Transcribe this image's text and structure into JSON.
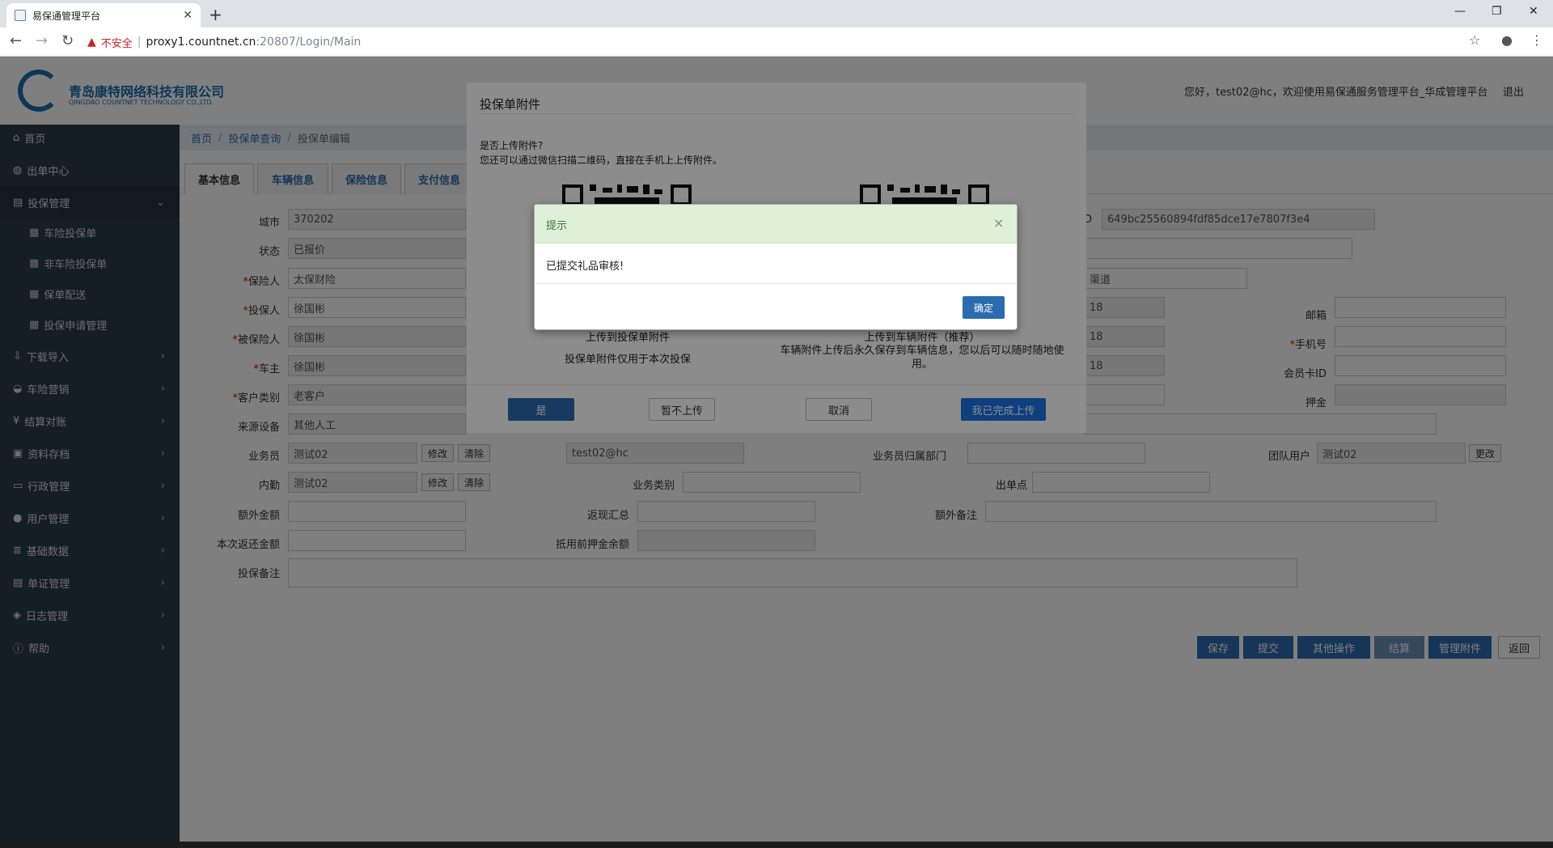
{
  "browser": {
    "tab_title": "易保通管理平台",
    "not_secure": "不安全",
    "url_host": "proxy1.countnet.cn",
    "url_rest": ":20807/Login/Main"
  },
  "header": {
    "company_cn": "青岛康特网络科技有限公司",
    "company_en": "QINGDAO COUNTNET TECHNOLOGY CO.,LTD.",
    "welcome": "您好，test02@hc，欢迎使用易保通服务管理平台_华成管理平台",
    "logout": "退出"
  },
  "sidebar": {
    "items": [
      {
        "label": "首页"
      },
      {
        "label": "出单中心"
      },
      {
        "label": "投保管理"
      },
      {
        "label": "车险投保单"
      },
      {
        "label": "非车险投保单"
      },
      {
        "label": "保单配送"
      },
      {
        "label": "投保申请管理"
      },
      {
        "label": "下载导入"
      },
      {
        "label": "车险营销"
      },
      {
        "label": "结算对账"
      },
      {
        "label": "资料存档"
      },
      {
        "label": "行政管理"
      },
      {
        "label": "用户管理"
      },
      {
        "label": "基础数据"
      },
      {
        "label": "单证管理"
      },
      {
        "label": "日志管理"
      },
      {
        "label": "帮助"
      }
    ]
  },
  "breadcrumb": [
    "首页",
    "投保单查询",
    "投保单编辑"
  ],
  "form_tabs": [
    "基本信息",
    "车辆信息",
    "保险信息",
    "支付信息"
  ],
  "form": {
    "city_label": "城市",
    "city_value": "370202",
    "status_label": "状态",
    "status_value": "已报价",
    "insurer_label": "保险人",
    "insurer_value": "太保财险",
    "applicant_label": "投保人",
    "applicant_value": "徐国彬",
    "insured_label": "被保险人",
    "insured_value": "徐国彬",
    "owner_label": "车主",
    "owner_value": "徐国彬",
    "customer_type_label": "客户类别",
    "customer_type_value": "老客户",
    "source_label": "来源设备",
    "source_value": "其他人工",
    "agent_label": "业务员",
    "agent_value": "测试02",
    "agent_account": "test02@hc",
    "internal_label": "内勤",
    "internal_value": "测试02",
    "modify": "修改",
    "clear": "清除",
    "dept_label": "业务员归属部门",
    "team_label": "团队用户",
    "team_value": "测试02",
    "team_change": "更改",
    "biz_type_label": "业务类别",
    "issue_point_label": "出单点",
    "extra_amount_label": "额外金额",
    "rebate_total_label": "返现汇总",
    "extra_note_label": "额外备注",
    "rebate_now_label": "本次返还金额",
    "deposit_balance_label": "抵用前押金余额",
    "note_label": "投保备注",
    "id_label": "ID",
    "id_value": "649bc25560894fdf85dce17e7807f3e4",
    "channel_value": "渠道",
    "email_label": "邮箱",
    "mobile_label": "手机号",
    "member_label": "会员卡ID",
    "deposit_label": "押金",
    "phone_tail": "18"
  },
  "actions": [
    "保存",
    "提交",
    "其他操作",
    "结算",
    "管理附件",
    "返回"
  ],
  "attach_dialog": {
    "title": "投保单附件",
    "question": "是否上传附件?",
    "hint": "您还可以通过微信扫描二维码，直接在手机上上传附件。",
    "upload_policy": "上传到投保单附件",
    "upload_policy_desc": "投保单附件仅用于本次投保",
    "upload_vehicle": "上传到车辆附件（推荐）",
    "upload_vehicle_desc": "车辆附件上传后永久保存到车辆信息，您以后可以随时随地使用。",
    "btn_yes": "是",
    "btn_skip": "暂不上传",
    "btn_cancel": "取消",
    "btn_done": "我已完成上传"
  },
  "alert_dialog": {
    "title": "提示",
    "message": "已提交礼品审核!",
    "ok": "确定"
  }
}
